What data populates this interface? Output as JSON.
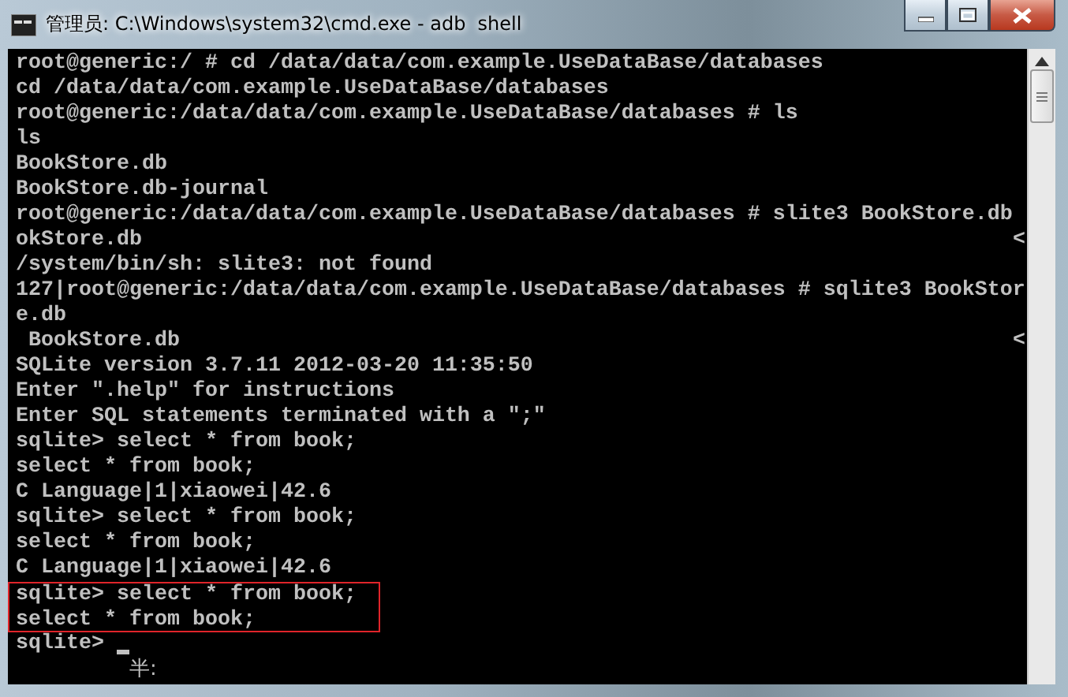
{
  "window": {
    "title": "管理员: C:\\Windows\\system32\\cmd.exe - adb  shell"
  },
  "lines": [
    {
      "text": "root@generic:/ # cd /data/data/com.example.UseDataBase/databases",
      "highlighted": false
    },
    {
      "text": "cd /data/data/com.example.UseDataBase/databases",
      "highlighted": false
    },
    {
      "text": "root@generic:/data/data/com.example.UseDataBase/databases # ls",
      "highlighted": false
    },
    {
      "text": "ls",
      "highlighted": false
    },
    {
      "text": "BookStore.db",
      "highlighted": false
    },
    {
      "text": "BookStore.db-journal",
      "highlighted": false
    },
    {
      "text": "root@generic:/data/data/com.example.UseDataBase/databases # slite3 BookStore.db",
      "highlighted": false
    },
    {
      "text": "okStore.db",
      "marker": "<",
      "highlighted": false
    },
    {
      "text": "/system/bin/sh: slite3: not found",
      "highlighted": false
    },
    {
      "text": "127|root@generic:/data/data/com.example.UseDataBase/databases # sqlite3 BookStor",
      "highlighted": false
    },
    {
      "text": "e.db",
      "highlighted": false
    },
    {
      "text": " BookStore.db",
      "marker": "<",
      "highlighted": false
    },
    {
      "text": "SQLite version 3.7.11 2012-03-20 11:35:50",
      "highlighted": false
    },
    {
      "text": "Enter \".help\" for instructions",
      "highlighted": false
    },
    {
      "text": "Enter SQL statements terminated with a \";\"",
      "highlighted": false
    },
    {
      "text": "sqlite> select * from book;",
      "highlighted": false
    },
    {
      "text": "select * from book;",
      "highlighted": false
    },
    {
      "text": "C Language|1|xiaowei|42.6",
      "highlighted": false
    },
    {
      "text": "sqlite> select * from book;",
      "highlighted": false
    },
    {
      "text": "select * from book;",
      "highlighted": false
    },
    {
      "text": "C Language|1|xiaowei|42.6",
      "highlighted": false
    },
    {
      "text": "sqlite> select * from book;",
      "highlighted": true
    },
    {
      "text": "select * from book;",
      "highlighted": true
    }
  ],
  "prompt": "sqlite>",
  "ime_status": "半:"
}
